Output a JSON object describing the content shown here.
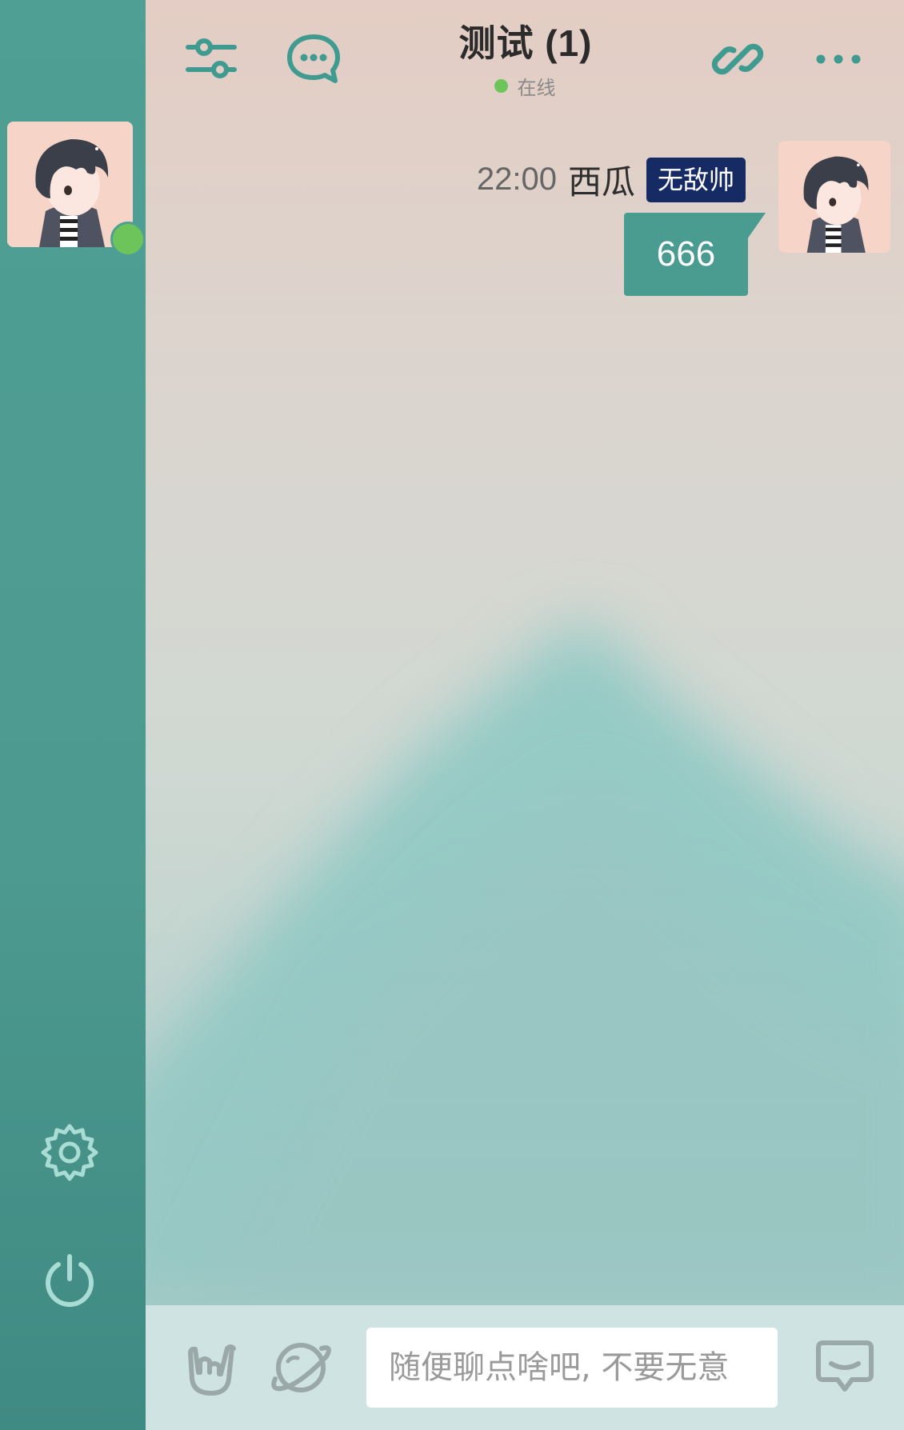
{
  "header": {
    "title": "测试 (1)",
    "status": "在线",
    "icons": [
      "sliders-icon",
      "chat-bubble-icon",
      "link-icon",
      "more-icon"
    ]
  },
  "sidebar": {
    "avatar": "anime-boy-avatar",
    "online": true,
    "buttons": [
      "gear-icon",
      "power-icon"
    ]
  },
  "message": {
    "time": "22:00",
    "sender": "西瓜",
    "badge": "无敌帅",
    "text": "666"
  },
  "composer": {
    "placeholder": "随便聊点啥吧, 不要无意",
    "value": "",
    "icons": [
      "rock-hand-icon",
      "planet-icon",
      "send-chat-icon"
    ]
  },
  "colors": {
    "accent": "#4f9f94",
    "online": "#6cc45b",
    "badge": "#162a63",
    "bubble": "#4a9c90"
  }
}
